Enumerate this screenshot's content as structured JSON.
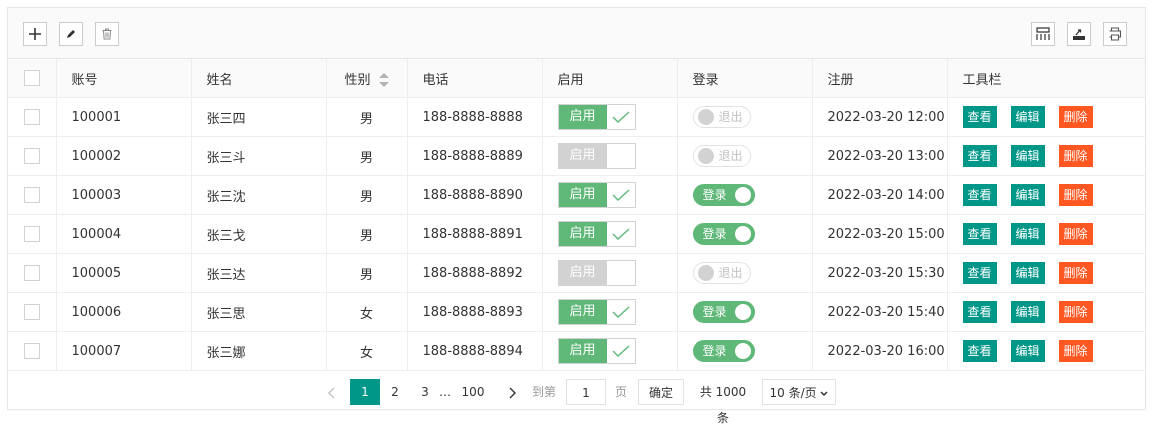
{
  "toolbar": {
    "left_icons": [
      "plus-icon",
      "pencil-icon",
      "trash-icon"
    ],
    "right_icons": [
      "columns-icon",
      "export-icon",
      "print-icon"
    ]
  },
  "headers": [
    "账号",
    "姓名",
    "性别",
    "电话",
    "启用",
    "登录",
    "注册",
    "工具栏"
  ],
  "rows": [
    {
      "account": "100001",
      "name": "张三四",
      "gender": "男",
      "phone": "188-8888-8888",
      "enabled": true,
      "logged": false,
      "registered": "2022-03-20 12:00"
    },
    {
      "account": "100002",
      "name": "张三斗",
      "gender": "男",
      "phone": "188-8888-8889",
      "enabled": false,
      "logged": false,
      "registered": "2022-03-20 13:00"
    },
    {
      "account": "100003",
      "name": "张三沈",
      "gender": "男",
      "phone": "188-8888-8890",
      "enabled": true,
      "logged": true,
      "registered": "2022-03-20 14:00"
    },
    {
      "account": "100004",
      "name": "张三戈",
      "gender": "男",
      "phone": "188-8888-8891",
      "enabled": true,
      "logged": true,
      "registered": "2022-03-20 15:00"
    },
    {
      "account": "100005",
      "name": "张三达",
      "gender": "男",
      "phone": "188-8888-8892",
      "enabled": false,
      "logged": false,
      "registered": "2022-03-20 15:30"
    },
    {
      "account": "100006",
      "name": "张三思",
      "gender": "女",
      "phone": "188-8888-8893",
      "enabled": true,
      "logged": true,
      "registered": "2022-03-20 15:40"
    },
    {
      "account": "100007",
      "name": "张三娜",
      "gender": "女",
      "phone": "188-8888-8894",
      "enabled": true,
      "logged": true,
      "registered": "2022-03-20 16:00"
    }
  ],
  "labels": {
    "enabled": "启用",
    "login_on": "登录",
    "login_off": "退出",
    "view": "查看",
    "edit": "编辑",
    "delete": "删除"
  },
  "pagination": {
    "pages": [
      "1",
      "2",
      "3"
    ],
    "ellipsis": "…",
    "last_page": "100",
    "current": "1",
    "goto_label": "到第",
    "goto_value": "1",
    "page_unit": "页",
    "confirm": "确定",
    "total": "共 1000 条",
    "page_size": "10 条/页"
  },
  "colors": {
    "primary": "#009688",
    "enabled_green": "#5fb878",
    "danger": "#ff5722",
    "disabled_gray": "#d2d2d2"
  }
}
